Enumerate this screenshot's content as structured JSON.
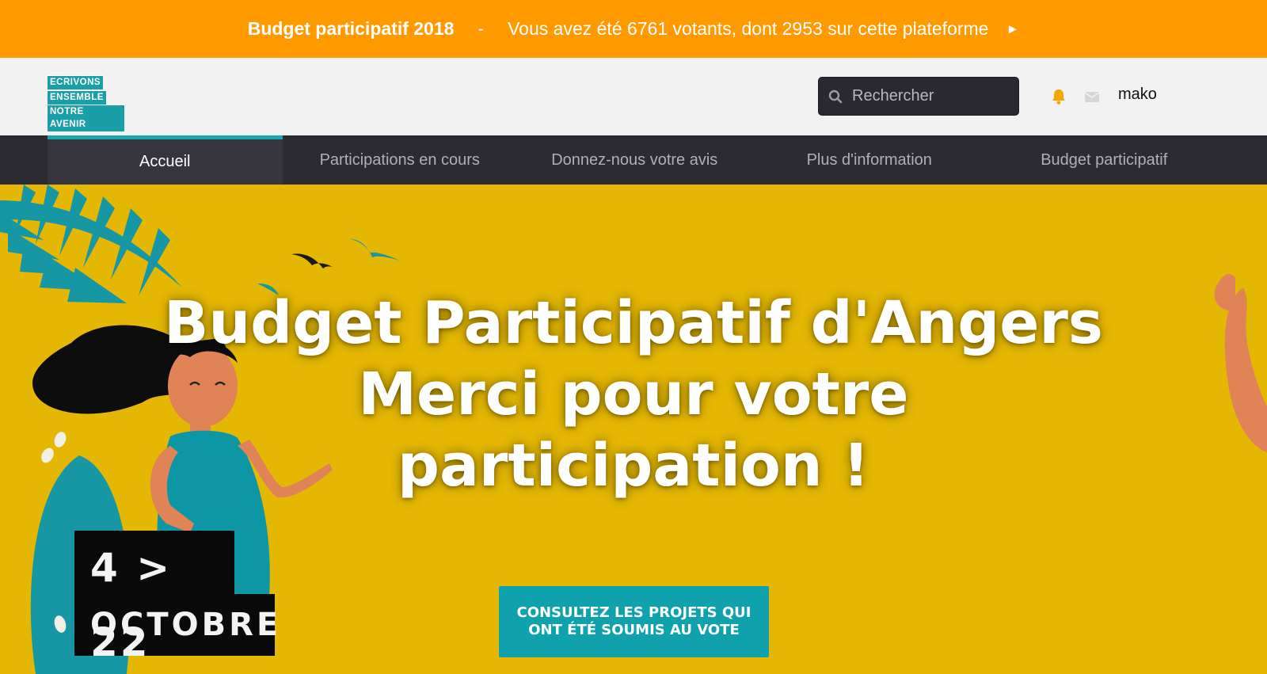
{
  "banner": {
    "title": "Budget participatif 2018",
    "separator": "-",
    "message": "Vous avez été 6761 votants, dont 2953 sur cette plateforme",
    "arrow": "►",
    "color": "#ff9900"
  },
  "header": {
    "logo": [
      "ECRIVONS",
      "ENSEMBLE",
      "NOTRE AVENIR"
    ],
    "search": {
      "placeholder": "Rechercher",
      "value": ""
    },
    "username": "mako"
  },
  "nav": {
    "items": [
      {
        "label": "Accueil",
        "active": true
      },
      {
        "label": "Participations en cours",
        "active": false
      },
      {
        "label": "Donnez-nous votre avis",
        "active": false
      },
      {
        "label": "Plus d'information",
        "active": false
      },
      {
        "label": "Budget participatif",
        "active": false
      }
    ],
    "accent": "#19a6ae"
  },
  "hero": {
    "title_lines": [
      "Budget Participatif d'Angers",
      "Merci pour votre",
      "participation !"
    ],
    "date_range": "4 > 22",
    "date_month": "OCTOBRE",
    "cta_line1": "CONSULTEZ LES PROJETS QUI",
    "cta_line2": "ONT ÉTÉ SOUMIS AU VOTE",
    "background": "#e4b702"
  },
  "icons": {
    "search": "search-icon",
    "notifications": "bell-icon",
    "messages": "mail-icon"
  }
}
